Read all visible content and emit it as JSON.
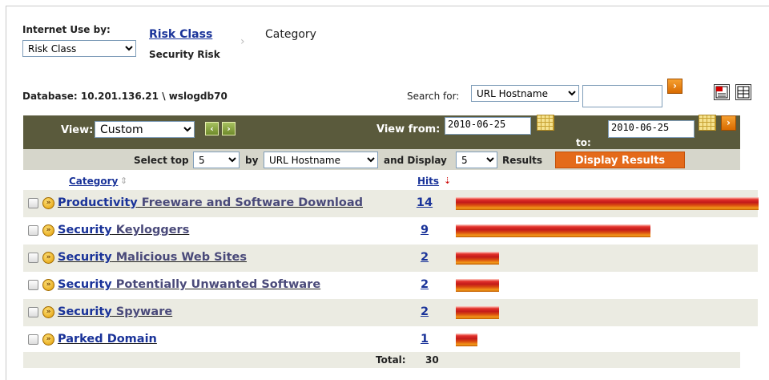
{
  "header": {
    "internet_use_label": "Internet Use by:",
    "risk_class_select": "Risk Class",
    "breadcrumb_link": "Risk Class",
    "breadcrumb_sub": "Security Risk",
    "breadcrumb_current": "Category",
    "database": "Database: 10.201.136.21 \\ wslogdb70"
  },
  "search": {
    "label": "Search for:",
    "select_value": "URL Hostname",
    "input_value": ""
  },
  "view": {
    "label": "View:",
    "select_value": "Custom",
    "from_label": "View from:",
    "from_date": "2010-06-25",
    "to_label": "to:",
    "to_date": "2010-06-25"
  },
  "filter": {
    "select_top_label": "Select top",
    "top_value": "5",
    "by_label": "by",
    "by_value": "URL Hostname",
    "and_display_label": "and Display",
    "display_value": "5",
    "results_label": "Results",
    "display_button": "Display Results"
  },
  "table": {
    "col_category": "Category",
    "col_hits": "Hits",
    "max_hits": 14,
    "rows": [
      {
        "risk": "Productivity",
        "name": " Freeware and Software Download",
        "hits": 14
      },
      {
        "risk": "Security",
        "name": " Keyloggers",
        "hits": 9
      },
      {
        "risk": "Security",
        "name": " Malicious Web Sites",
        "hits": 2
      },
      {
        "risk": "Security",
        "name": " Potentially Unwanted Software",
        "hits": 2
      },
      {
        "risk": "Security",
        "name": " Spyware",
        "hits": 2
      },
      {
        "risk": "",
        "name": "Parked Domain",
        "hits": 1
      }
    ],
    "total_label": "Total:",
    "total_value": "30"
  },
  "colors": {
    "viewbar": "#5a5a3c",
    "filterbar": "#d6d6cb",
    "link": "#1a3399",
    "accent": "#e46a1a"
  },
  "icons": [
    "dropdown-arrow-icon",
    "forward-arrow-icon",
    "calendar-icon",
    "previous-icon",
    "next-icon",
    "pdf-icon",
    "excel-icon",
    "risk-icon",
    "sort-icon"
  ]
}
